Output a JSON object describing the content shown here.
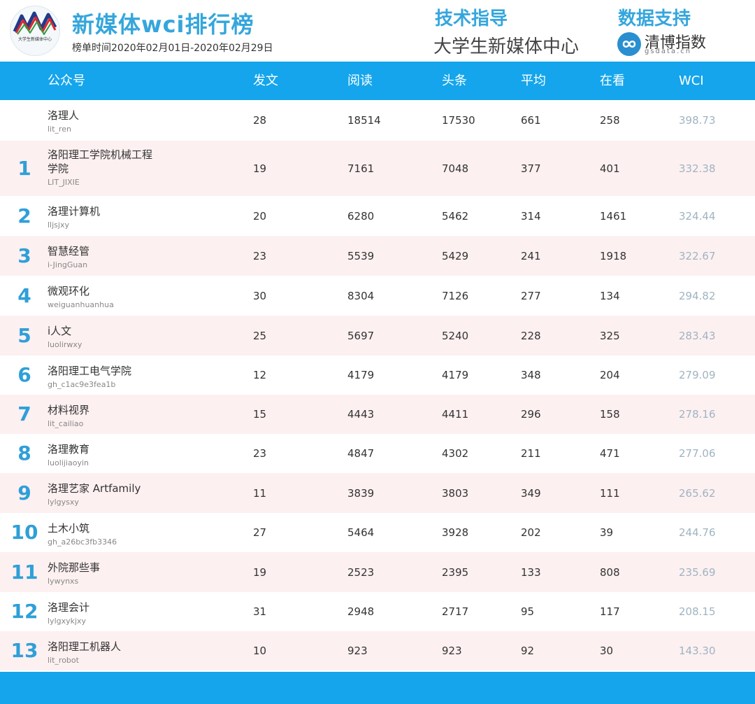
{
  "header": {
    "title": "新媒体wci排行榜",
    "period": "榜单时间2020年02月01日-2020年02月29日",
    "logo_caption": "大学生新媒体中心",
    "tech_label": "技术指导",
    "tech_value": "大学生新媒体中心",
    "support_label": "数据支持",
    "brand_name": "清博指数",
    "brand_domain": "gsdata.cn"
  },
  "columns": [
    "公众号",
    "发文",
    "阅读",
    "头条",
    "平均",
    "在看",
    "WCI"
  ],
  "rows": [
    {
      "rank": "",
      "name": "洛理人",
      "account": "lit_ren",
      "posts": "28",
      "reads": "18514",
      "headline": "17530",
      "avg": "661",
      "looking": "258",
      "wci": "398.73"
    },
    {
      "rank": "1",
      "name": "洛阳理工学院机械工程学院",
      "account": "LIT_JIXIE",
      "posts": "19",
      "reads": "7161",
      "headline": "7048",
      "avg": "377",
      "looking": "401",
      "wci": "332.38"
    },
    {
      "rank": "2",
      "name": "洛理计算机",
      "account": "lljsjxy",
      "posts": "20",
      "reads": "6280",
      "headline": "5462",
      "avg": "314",
      "looking": "1461",
      "wci": "324.44"
    },
    {
      "rank": "3",
      "name": "智慧经管",
      "account": "i-JingGuan",
      "posts": "23",
      "reads": "5539",
      "headline": "5429",
      "avg": "241",
      "looking": "1918",
      "wci": "322.67"
    },
    {
      "rank": "4",
      "name": "微观环化",
      "account": "weiguanhuanhua",
      "posts": "30",
      "reads": "8304",
      "headline": "7126",
      "avg": "277",
      "looking": "134",
      "wci": "294.82"
    },
    {
      "rank": "5",
      "name": "i人文",
      "account": "luolirwxy",
      "posts": "25",
      "reads": "5697",
      "headline": "5240",
      "avg": "228",
      "looking": "325",
      "wci": "283.43"
    },
    {
      "rank": "6",
      "name": "洛阳理工电气学院",
      "account": "gh_c1ac9e3fea1b",
      "posts": "12",
      "reads": "4179",
      "headline": "4179",
      "avg": "348",
      "looking": "204",
      "wci": "279.09"
    },
    {
      "rank": "7",
      "name": "材料视界",
      "account": "lit_cailiao",
      "posts": "15",
      "reads": "4443",
      "headline": "4411",
      "avg": "296",
      "looking": "158",
      "wci": "278.16"
    },
    {
      "rank": "8",
      "name": "洛理教育",
      "account": "luolijiaoyin",
      "posts": "23",
      "reads": "4847",
      "headline": "4302",
      "avg": "211",
      "looking": "471",
      "wci": "277.06"
    },
    {
      "rank": "9",
      "name": "洛理艺家 Artfamily",
      "account": "lylgysxy",
      "posts": "11",
      "reads": "3839",
      "headline": "3803",
      "avg": "349",
      "looking": "111",
      "wci": "265.62"
    },
    {
      "rank": "10",
      "name": "土木小筑",
      "account": "gh_a26bc3fb3346",
      "posts": "27",
      "reads": "5464",
      "headline": "3928",
      "avg": "202",
      "looking": "39",
      "wci": "244.76"
    },
    {
      "rank": "11",
      "name": "外院那些事",
      "account": "lywynxs",
      "posts": "19",
      "reads": "2523",
      "headline": "2395",
      "avg": "133",
      "looking": "808",
      "wci": "235.69"
    },
    {
      "rank": "12",
      "name": "洛理会计",
      "account": "lylgxykjxy",
      "posts": "31",
      "reads": "2948",
      "headline": "2717",
      "avg": "95",
      "looking": "117",
      "wci": "208.15"
    },
    {
      "rank": "13",
      "name": "洛阳理工机器人",
      "account": "lit_robot",
      "posts": "10",
      "reads": "923",
      "headline": "923",
      "avg": "92",
      "looking": "30",
      "wci": "143.30"
    }
  ],
  "colors": {
    "accent": "#14a5ec",
    "title": "#35a6dc",
    "rank": "#2f9fd8",
    "alt_row": "#fdf0f1",
    "wci_text": "#9fb4c2"
  }
}
